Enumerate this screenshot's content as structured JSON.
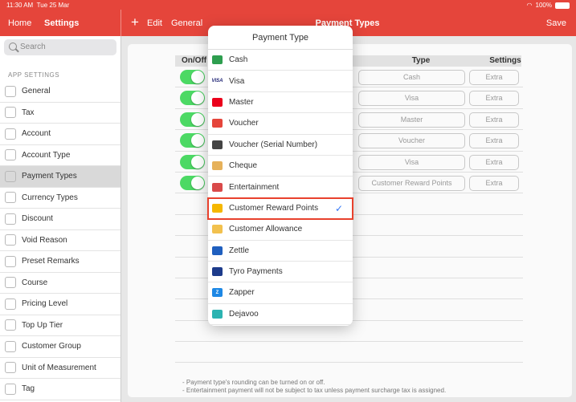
{
  "status": {
    "time": "11:30 AM",
    "date": "Tue 25 Mar",
    "battery": "100%"
  },
  "nav": {
    "home": "Home",
    "settings": "Settings",
    "plus": "+",
    "edit": "Edit",
    "general": "General",
    "title": "Payment Types",
    "save": "Save"
  },
  "sidebar": {
    "search_placeholder": "Search",
    "section": "APP SETTINGS",
    "items": [
      {
        "label": "General"
      },
      {
        "label": "Tax"
      },
      {
        "label": "Account"
      },
      {
        "label": "Account Type"
      },
      {
        "label": "Payment Types",
        "active": true
      },
      {
        "label": "Currency Types"
      },
      {
        "label": "Discount"
      },
      {
        "label": "Void Reason"
      },
      {
        "label": "Preset Remarks"
      },
      {
        "label": "Course"
      },
      {
        "label": "Pricing Level"
      },
      {
        "label": "Top Up Tier"
      },
      {
        "label": "Customer Group"
      },
      {
        "label": "Unit of Measurement"
      },
      {
        "label": "Tag"
      }
    ]
  },
  "table": {
    "headers": {
      "onoff": "On/Off",
      "type": "Type",
      "settings": "Settings"
    },
    "rows": [
      {
        "type": "Cash",
        "extra": "Extra"
      },
      {
        "type": "Visa",
        "extra": "Extra"
      },
      {
        "type": "Master",
        "extra": "Extra"
      },
      {
        "type": "Voucher",
        "extra": "Extra"
      },
      {
        "type": "Visa",
        "extra": "Extra"
      },
      {
        "type": "Customer Reward Points",
        "extra": "Extra"
      }
    ],
    "notes": [
      "- Payment type's rounding can be turned on or off.",
      "- Entertainment payment will not be subject to tax unless payment surcharge tax is assigned."
    ]
  },
  "popover": {
    "title": "Payment Type",
    "items": [
      {
        "label": "Cash",
        "icon": "cash-icon",
        "color": "#2e9e4f"
      },
      {
        "label": "Visa",
        "icon": "visa-icon",
        "color": "#1a1f71",
        "text": "VISA"
      },
      {
        "label": "Master",
        "icon": "mastercard-icon",
        "color": "#eb001b"
      },
      {
        "label": "Voucher",
        "icon": "voucher-icon",
        "color": "#e5453b"
      },
      {
        "label": "Voucher (Serial Number)",
        "icon": "barcode-icon",
        "color": "#444444"
      },
      {
        "label": "Cheque",
        "icon": "cheque-icon",
        "color": "#e6b15a"
      },
      {
        "label": "Entertainment",
        "icon": "entertainment-icon",
        "color": "#d94a4a"
      },
      {
        "label": "Customer Reward Points",
        "icon": "reward-icon",
        "color": "#f5b700",
        "selected": true
      },
      {
        "label": "Customer Allowance",
        "icon": "allowance-icon",
        "color": "#f2c14e"
      },
      {
        "label": "Zettle",
        "icon": "paypal-icon",
        "color": "#1f5fbf"
      },
      {
        "label": "Tyro Payments",
        "icon": "tyro-icon",
        "color": "#1d3b8b"
      },
      {
        "label": "Zapper",
        "icon": "zapper-icon",
        "color": "#1e88e5",
        "text": "Z"
      },
      {
        "label": "Dejavoo",
        "icon": "dejavoo-icon",
        "color": "#2bb3b1"
      }
    ],
    "check": "✓"
  }
}
